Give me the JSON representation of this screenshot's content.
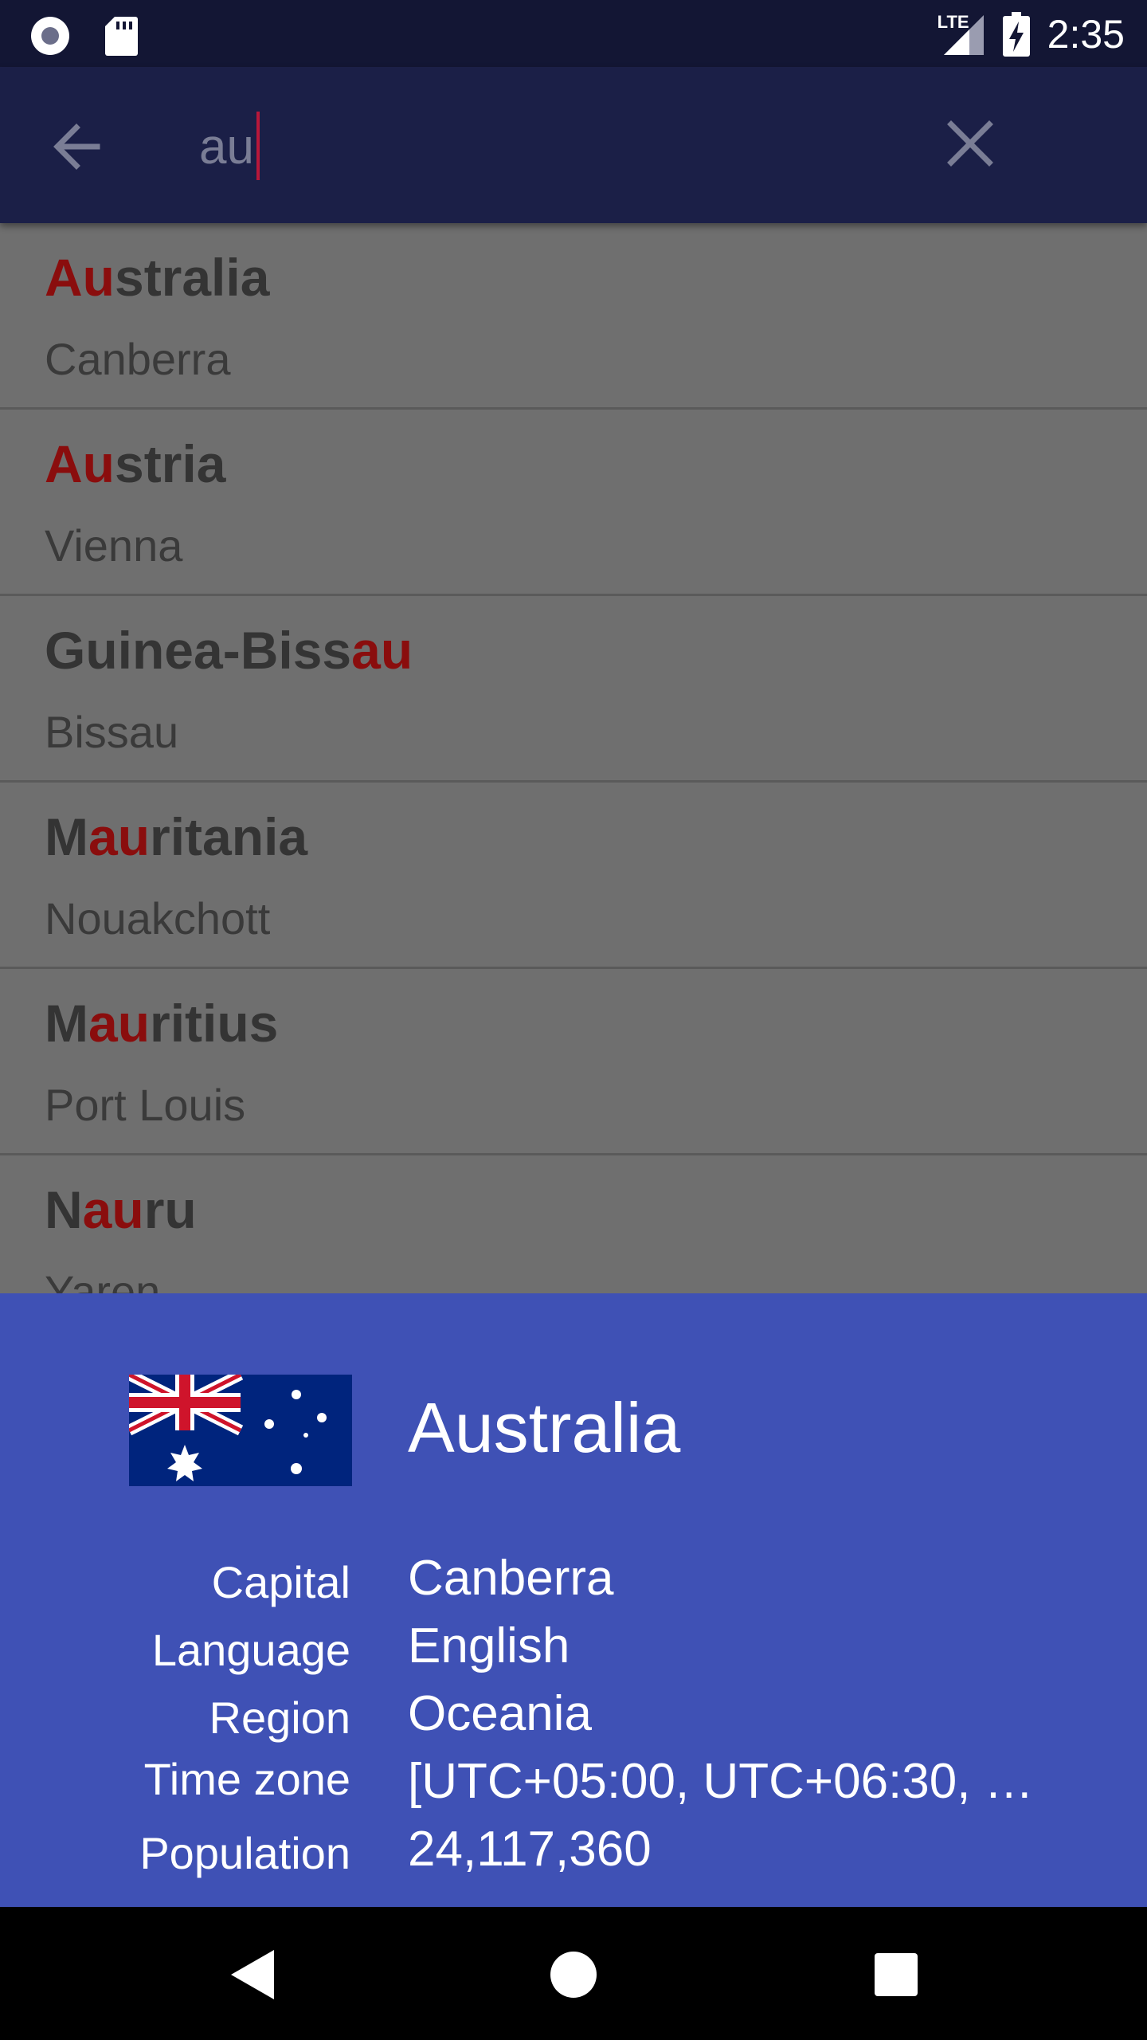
{
  "status_bar": {
    "time": "2:35",
    "network_label": "LTE",
    "icons": [
      "record-icon",
      "sd-card-icon",
      "lte-signal-icon",
      "battery-charging-icon"
    ]
  },
  "search": {
    "query": "au",
    "placeholder": ""
  },
  "results": [
    {
      "name_parts": [
        {
          "text": "Au",
          "hl": true
        },
        {
          "text": "stralia",
          "hl": false
        }
      ],
      "capital": "Canberra"
    },
    {
      "name_parts": [
        {
          "text": "Au",
          "hl": true
        },
        {
          "text": "stria",
          "hl": false
        }
      ],
      "capital": "Vienna"
    },
    {
      "name_parts": [
        {
          "text": "Guinea-Biss",
          "hl": false
        },
        {
          "text": "au",
          "hl": true
        }
      ],
      "capital": "Bissau"
    },
    {
      "name_parts": [
        {
          "text": "M",
          "hl": false
        },
        {
          "text": "au",
          "hl": true
        },
        {
          "text": "ritania",
          "hl": false
        }
      ],
      "capital": "Nouakchott"
    },
    {
      "name_parts": [
        {
          "text": "M",
          "hl": false
        },
        {
          "text": "au",
          "hl": true
        },
        {
          "text": "ritius",
          "hl": false
        }
      ],
      "capital": "Port Louis"
    },
    {
      "name_parts": [
        {
          "text": "N",
          "hl": false
        },
        {
          "text": "au",
          "hl": true
        },
        {
          "text": "ru",
          "hl": false
        }
      ],
      "capital": "Yaren"
    }
  ],
  "detail": {
    "country": "Australia",
    "rows": [
      {
        "label": "Capital",
        "value": "Canberra"
      },
      {
        "label": "Language",
        "value": "English"
      },
      {
        "label": "Region",
        "value": "Oceania"
      },
      {
        "label": "Time zone",
        "value": "[UTC+05:00, UTC+06:30, …"
      },
      {
        "label": "Population",
        "value": "24,117,360"
      }
    ]
  },
  "colors": {
    "status_bar": "#131634",
    "app_bar": "#1b1f47",
    "highlight": "#8a0d0d",
    "sheet": "#3f51b5",
    "caret": "#b8173a"
  }
}
